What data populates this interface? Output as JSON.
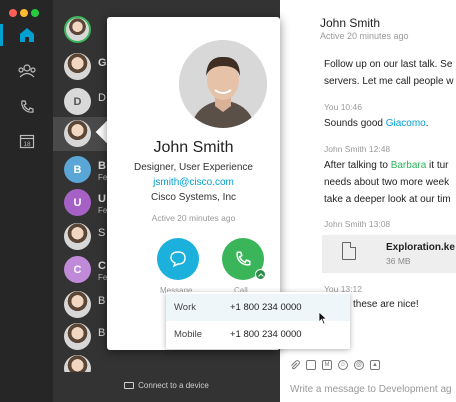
{
  "rail": {
    "colors": {
      "close": "#ff5f57",
      "minimize": "#febc2e",
      "zoom": "#28c840",
      "active_accent": "#00a0d1"
    },
    "items": [
      {
        "icon": "home-icon",
        "active": true
      },
      {
        "icon": "team-icon",
        "active": false
      },
      {
        "icon": "phone-icon",
        "active": false
      },
      {
        "icon": "calendar-icon",
        "label": "18",
        "active": false
      }
    ]
  },
  "contact_list": {
    "items": [
      {
        "avatar": "photo",
        "name": "",
        "sub": ""
      },
      {
        "avatar": "photo",
        "name": "G",
        "sub": ""
      },
      {
        "avatar": "initial",
        "initial": "D",
        "color": "#d9d9d9",
        "name": "D",
        "sub": ""
      },
      {
        "avatar": "photo",
        "name": "",
        "sub": "",
        "selected": true
      },
      {
        "avatar": "initial",
        "initial": "B",
        "color": "#5aa6d6",
        "name": "B",
        "sub": "Fe"
      },
      {
        "avatar": "initial",
        "initial": "U",
        "color": "#a661c6",
        "name": "U",
        "sub": "Fe"
      },
      {
        "avatar": "photo",
        "name": "S",
        "sub": ""
      },
      {
        "avatar": "initial",
        "initial": "C",
        "color": "#c08ad8",
        "name": "C",
        "sub": "Fe"
      },
      {
        "avatar": "photo",
        "name": "B",
        "sub": ""
      },
      {
        "avatar": "photo",
        "name": "B",
        "sub": ""
      },
      {
        "avatar": "photo",
        "name": "",
        "sub": ""
      }
    ],
    "connect_label": "Connect to a device"
  },
  "chat": {
    "title": "John Smith",
    "status": "Active 20 minutes ago",
    "messages": [
      {
        "meta": "",
        "lines": [
          "Follow up on our last talk. Se",
          "servers. Let me call people w"
        ]
      },
      {
        "meta": "You  10:46",
        "lines": [
          "Sounds good "
        ],
        "mention": "Giacomo",
        "mention_suffix": "."
      },
      {
        "meta": "John Smith  12:48",
        "line1_prefix": "After talking to ",
        "line1_mention": "Barbara",
        "line1_suffix": " it tur",
        "lines": [
          "needs about two more week",
          "take a deeper look at our tim"
        ]
      },
      {
        "meta": "John Smith  13:08"
      },
      {
        "meta": "You  13:12",
        "lines": [
          "these are nice!"
        ]
      }
    ],
    "file": {
      "name": "Exploration.ke",
      "size": "36 MB"
    },
    "composer_placeholder": "Write a message to Development ag"
  },
  "card": {
    "name": "John Smith",
    "title": "Designer, User Experience",
    "email": "jsmith@cisco.com",
    "company": "Cisco Systems, Inc",
    "status": "Active 20 minutes ago",
    "message_label": "Message",
    "call_label": "Call",
    "colors": {
      "message": "#1bb1dc",
      "call": "#3ab55a",
      "email": "#00a0d1"
    }
  },
  "phone_menu": {
    "options": [
      {
        "type": "Work",
        "number": "+1 800 234 0000",
        "hovered": true
      },
      {
        "type": "Mobile",
        "number": "+1 800 234 0000",
        "hovered": false
      }
    ]
  }
}
